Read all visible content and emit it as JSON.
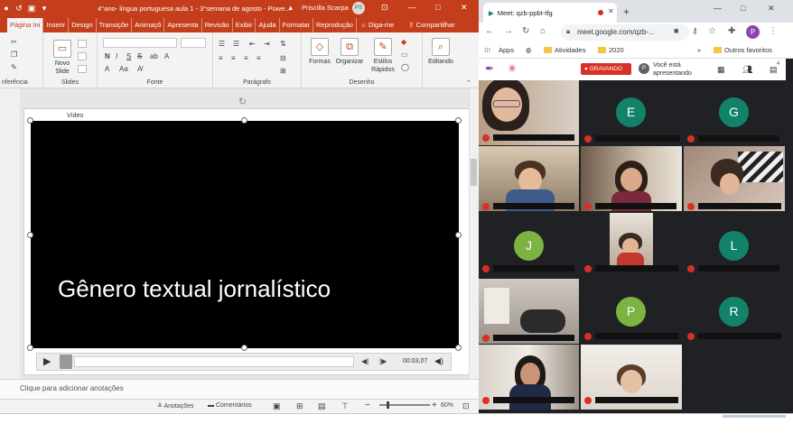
{
  "colors": {
    "ppt_accent": "#c43e1c",
    "meet_bg": "#202124",
    "rec_red": "#d93025"
  },
  "ppt": {
    "doc_title": "4°ano- lingua portuguesa aula 1 - 3°semana de agosto  -  Powe...",
    "user_name": "Priscilla Scarpa",
    "user_initials": "PS",
    "tabs": [
      "Página Ini",
      "Inserir",
      "Design",
      "Transiçõe",
      "Animaçõ",
      "Apresenta",
      "Revisão",
      "Exibir",
      "Ajuda",
      "Formatar",
      "Reprodução",
      "Diga-me",
      "Compartilhar"
    ],
    "ribbon": {
      "groups": [
        "nferência",
        "Slides",
        "Fonte",
        "Parágrafo",
        "Desenho",
        ""
      ],
      "buttons": {
        "new_slide": [
          "Novo",
          "Slide"
        ],
        "shapes": "Formas",
        "arrange": "Organizar",
        "quick_styles": [
          "Estilos",
          "Rápidos"
        ],
        "editing": "Editando"
      }
    },
    "video_label": "Vídeo",
    "video_title": "Gênero textual jornalístico",
    "player_time": "00:03,07",
    "notes_placeholder": "Clique para adicionar anotações",
    "status": {
      "notes": "Anotações",
      "comments": "Comentários",
      "zoom": "60%"
    }
  },
  "chrome": {
    "tab_title": "Meet: qzb-ppbt-tfg",
    "url": "meet.google.com/qzb-...",
    "profile_initial": "P",
    "bookmarks": [
      "Apps",
      "Atividades",
      "2020",
      "»",
      "Outros favoritos"
    ]
  },
  "meet": {
    "recording_label": "GRAVANDO",
    "presenting_text": [
      "Você está",
      "apresentando"
    ],
    "badge_count": "4",
    "participants": [
      "E",
      "G",
      "J",
      "L",
      "P",
      "R"
    ],
    "avatar_colors": {
      "E": "#12826a",
      "G": "#12826a",
      "J": "#7cb342",
      "L": "#12826a",
      "P": "#7cb342",
      "R": "#12826a"
    }
  }
}
